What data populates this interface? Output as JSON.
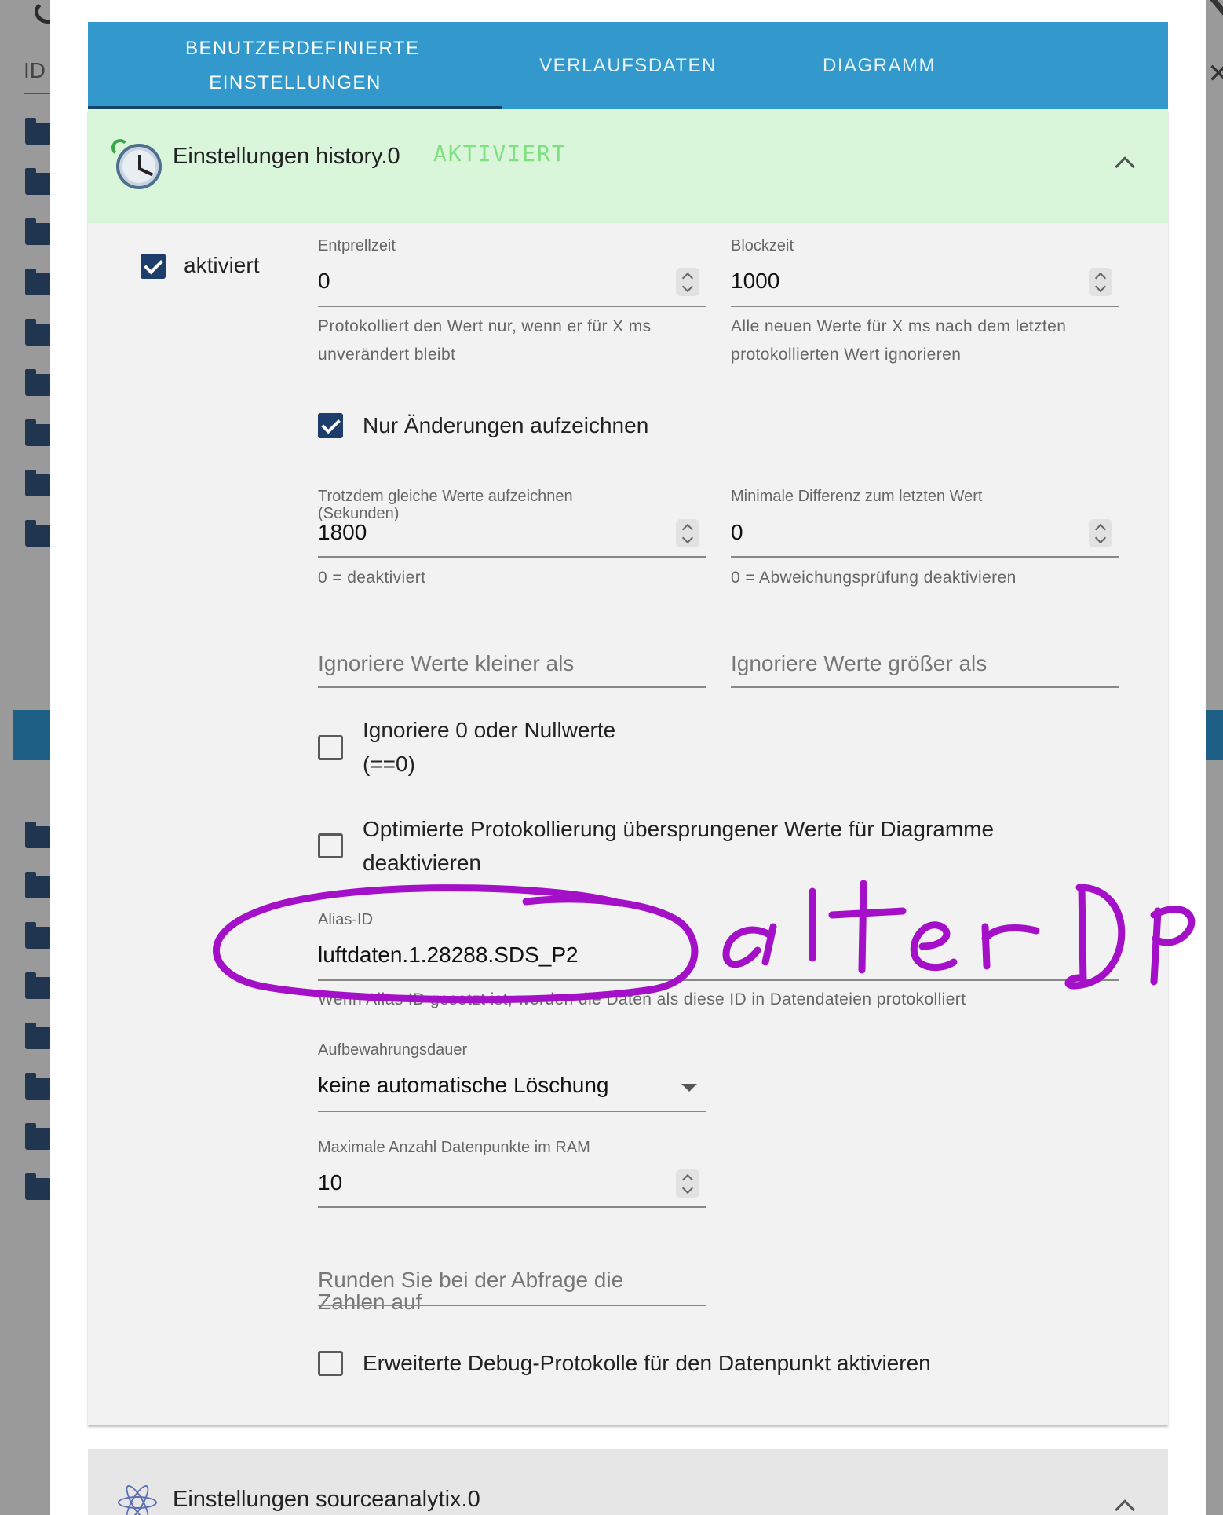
{
  "background": {
    "id_label": "ID"
  },
  "tabs": [
    {
      "label": "BENUTZERDEFINIERTE EINSTELLUNGEN"
    },
    {
      "label": "VERLAUFSDATEN"
    },
    {
      "label": "DIAGRAMM"
    }
  ],
  "panel": {
    "title": "Einstellungen history.0",
    "status": "AKTIVIERT",
    "icon": "clock-icon",
    "enabled": {
      "label": "aktiviert",
      "checked": true
    },
    "entprellzeit": {
      "label": "Entprellzeit",
      "value": "0",
      "help": "Protokolliert den Wert nur, wenn er für X ms unverändert bleibt"
    },
    "blockzeit": {
      "label": "Blockzeit",
      "value": "1000",
      "help": "Alle neuen Werte für X ms nach dem letzten protokollierten Wert ignorieren"
    },
    "nur_aenderungen": {
      "label": "Nur Änderungen aufzeichnen",
      "checked": true
    },
    "trotzdem": {
      "label": "Trotzdem gleiche Werte aufzeichnen (Sekunden)",
      "value": "1800",
      "help": "0 = deaktiviert"
    },
    "min_diff": {
      "label": "Minimale Differenz zum letzten Wert",
      "value": "0",
      "help": "0 = Abweichungsprüfung deaktivieren"
    },
    "ignore_lower": {
      "placeholder": "Ignoriere Werte kleiner als"
    },
    "ignore_higher": {
      "placeholder": "Ignoriere Werte größer als"
    },
    "ignore_zero": {
      "label": "Ignoriere 0 oder Nullwerte (==0)",
      "checked": false
    },
    "optimized": {
      "label": "Optimierte Protokollierung übersprungener Werte für Diagramme deaktivieren",
      "checked": false
    },
    "alias": {
      "label": "Alias-ID",
      "value": "luftdaten.1.28288.SDS_P2",
      "help": "Wenn Alias ID gesetzt ist, werden die Daten als diese ID in Datendateien protokolliert"
    },
    "retention": {
      "label": "Aufbewahrungsdauer",
      "value": "keine automatische Löschung"
    },
    "max_ram": {
      "label": "Maximale Anzahl Datenpunkte im RAM",
      "value": "10"
    },
    "round": {
      "placeholder": "Runden Sie bei der Abfrage die Zahlen auf"
    },
    "debug": {
      "label": "Erweiterte Debug-Protokolle für den Datenpunkt aktivieren",
      "checked": false
    }
  },
  "panel2": {
    "title": "Einstellungen sourceanalytix.0",
    "icon": "atom-icon"
  },
  "annotation": {
    "text": "alter DP",
    "color": "#a410c8"
  }
}
